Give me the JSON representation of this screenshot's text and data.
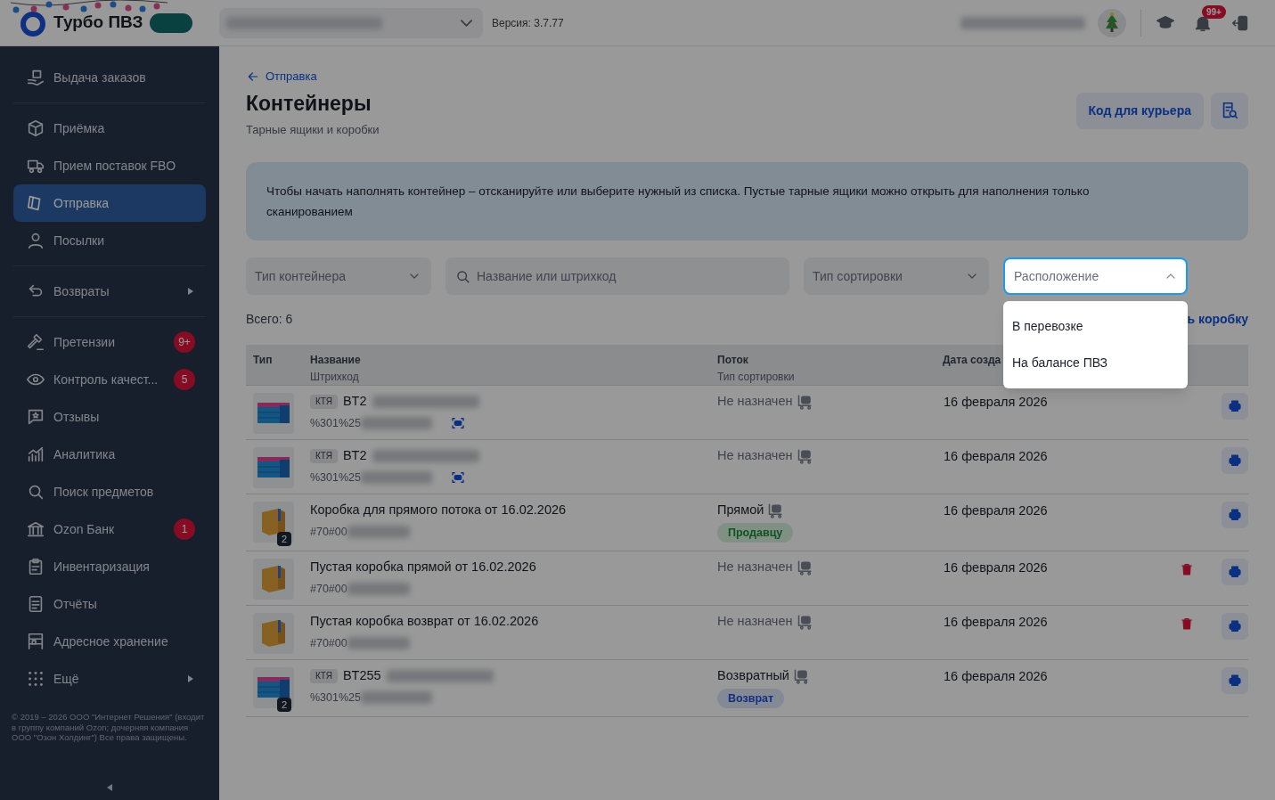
{
  "header": {
    "logo_text": "Турбо ПВЗ",
    "version": "Версия: 3.7.77",
    "notifications_badge": "99+"
  },
  "sidebar": {
    "groups": [
      [
        {
          "label": "Выдача заказов",
          "selected": false
        }
      ],
      [
        {
          "label": "Приёмка",
          "selected": false
        },
        {
          "label": "Прием поставок FBO",
          "selected": false
        },
        {
          "label": "Отправка",
          "selected": true
        },
        {
          "label": "Посылки",
          "selected": false
        }
      ],
      [
        {
          "label": "Возвраты",
          "selected": false,
          "submenu": true
        }
      ],
      [
        {
          "label": "Претензии",
          "selected": false,
          "badge": "9+"
        },
        {
          "label": "Контроль качест...",
          "selected": false,
          "badge": "5"
        },
        {
          "label": "Отзывы",
          "selected": false
        },
        {
          "label": "Аналитика",
          "selected": false
        },
        {
          "label": "Поиск предметов",
          "selected": false
        },
        {
          "label": "Ozon Банк",
          "selected": false,
          "badge": "1"
        },
        {
          "label": "Инвентаризация",
          "selected": false
        },
        {
          "label": "Отчёты",
          "selected": false
        },
        {
          "label": "Адресное хранение",
          "selected": false
        },
        {
          "label": "Ещё",
          "selected": false,
          "submenu": true
        }
      ]
    ],
    "footer": "© 2019 – 2026 ООО \"Интернет Решения\" (входит в группу компаний Ozon; дочерняя компания ООО \"Озон Холдинг\") Все права защищены."
  },
  "page": {
    "back_link": "Отправка",
    "title": "Контейнеры",
    "subtitle": "Тарные ящики и коробки",
    "courier_button": "Код для курьера",
    "notice": "Чтобы начать наполнять контейнер – отсканируйте или выберите нужный из списка. Пустые тарные ящики можно открыть для наполнения только сканированием",
    "filters": [
      {
        "kind": "select",
        "placeholder": "Тип контейнера",
        "expanded": false
      },
      {
        "kind": "search",
        "placeholder": "Название или штрихкод",
        "expanded": false
      },
      {
        "kind": "select",
        "placeholder": "Тип сортировки",
        "expanded": false
      },
      {
        "kind": "select",
        "placeholder": "Расположение",
        "expanded": true
      }
    ],
    "dropdown_options": [
      "В перевозке",
      "На балансе ПВЗ"
    ],
    "total": "Всего: 6",
    "create_link": "ь коробку",
    "table": {
      "columns": [
        {
          "title": "Тип"
        },
        {
          "title": "Название",
          "subtitle": "Штрихкод"
        },
        {
          "title": "Поток",
          "subtitle": "Тип сортировки"
        },
        {
          "title": "Дата созда"
        }
      ],
      "rows": [
        {
          "kind": "crate",
          "tag": "КТЯ",
          "name": "BT2",
          "barcode": "%301%25",
          "scan": true,
          "flow": "Не назначен",
          "assigned": false,
          "date": "16 февраля 2026",
          "deletable": false
        },
        {
          "kind": "crate",
          "tag": "КТЯ",
          "name": "BT2",
          "barcode": "%301%25",
          "scan": true,
          "flow": "Не назначен",
          "assigned": false,
          "date": "16 февраля 2026",
          "deletable": false
        },
        {
          "kind": "box",
          "count": "2",
          "name": "Коробка для прямого потока от 16.02.2026",
          "barcode": "#70#00",
          "scan": false,
          "flow": "Прямой",
          "assigned": true,
          "flow_tag": {
            "text": "Продавцу",
            "kind": "seller"
          },
          "date": "16 февраля 2026",
          "deletable": false
        },
        {
          "kind": "box",
          "name": "Пустая коробка прямой от 16.02.2026",
          "barcode": "#70#00",
          "scan": false,
          "flow": "Не назначен",
          "assigned": false,
          "date": "16 февраля 2026",
          "deletable": true
        },
        {
          "kind": "box",
          "name": "Пустая коробка возврат от 16.02.2026",
          "barcode": "#70#00",
          "scan": false,
          "flow": "Не назначен",
          "assigned": false,
          "date": "16 февраля 2026",
          "deletable": true
        },
        {
          "kind": "crate",
          "count": "2",
          "tag": "КТЯ",
          "name": "BT255",
          "barcode": "%301%25",
          "scan": false,
          "flow": "Возвратный",
          "assigned": true,
          "flow_tag": {
            "text": "Возврат",
            "kind": "return"
          },
          "date": "16 февраля 2026",
          "deletable": false
        }
      ]
    }
  }
}
